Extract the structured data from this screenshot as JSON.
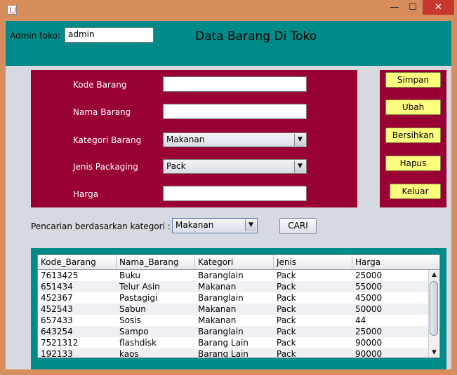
{
  "window": {
    "close": "✕",
    "minimize": "—",
    "maximize": "☐"
  },
  "header": {
    "admin_label": "Admin toko:",
    "admin_value": "admin",
    "title": "Data Barang Di Toko"
  },
  "form": {
    "kode_label": "Kode Barang",
    "kode_value": "",
    "nama_label": "Nama Barang",
    "nama_value": "",
    "kategori_label": "Kategori Barang",
    "kategori_value": "Makanan",
    "jenis_label": "Jenis Packaging",
    "jenis_value": "Pack",
    "harga_label": "Harga",
    "harga_value": ""
  },
  "buttons": {
    "simpan": "Simpan",
    "ubah": "Ubah",
    "bersihkan": "Bersihkan",
    "hapus": "Hapus",
    "keluar": "Keluar"
  },
  "search": {
    "label": "Pencarian berdasarkan kategori :",
    "value": "Makanan",
    "button": "CARI"
  },
  "table": {
    "columns": [
      "Kode_Barang",
      "Nama_Barang",
      "Kategori",
      "Jenis",
      "Harga"
    ],
    "rows": [
      [
        "7613425",
        "Buku",
        "Baranglain",
        "Pack",
        "25000"
      ],
      [
        "651434",
        "Telur Asin",
        "Makanan",
        "Pack",
        "55000"
      ],
      [
        "452367",
        "Pastagigi",
        "Baranglain",
        "Pack",
        "45000"
      ],
      [
        "452543",
        "Sabun",
        "Makanan",
        "Pack",
        "50000"
      ],
      [
        "657433",
        "Sosis",
        "Makanan",
        "Pack",
        "44"
      ],
      [
        "643254",
        "Sampo",
        "Baranglain",
        "Pack",
        "25000"
      ],
      [
        "7521312",
        "flashdisk",
        "Barang Lain",
        "Pack",
        "90000"
      ],
      [
        "192133",
        "kaos",
        "Barang Lain",
        "Pack",
        "90000"
      ]
    ]
  }
}
